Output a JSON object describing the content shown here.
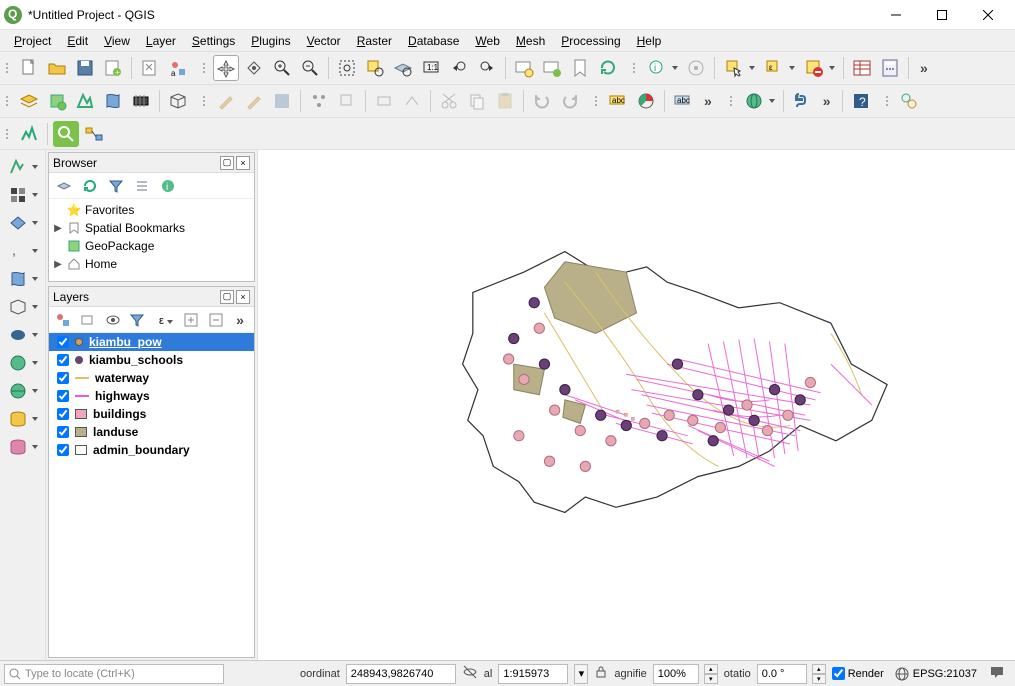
{
  "title": "*Untitled Project - QGIS",
  "menu": [
    "Project",
    "Edit",
    "View",
    "Layer",
    "Settings",
    "Plugins",
    "Vector",
    "Raster",
    "Database",
    "Web",
    "Mesh",
    "Processing",
    "Help"
  ],
  "browser": {
    "panel_title": "Browser",
    "items": [
      {
        "label": "Favorites",
        "icon": "star",
        "expandable": false
      },
      {
        "label": "Spatial Bookmarks",
        "icon": "bookmark",
        "expandable": true
      },
      {
        "label": "GeoPackage",
        "icon": "geopackage",
        "expandable": false
      },
      {
        "label": "Home",
        "icon": "home",
        "expandable": true
      }
    ]
  },
  "layers": {
    "panel_title": "Layers",
    "items": [
      {
        "name": "kiambu_pow",
        "checked": true,
        "selected": true,
        "swatch_type": "point",
        "color": "#d0a060"
      },
      {
        "name": "kiambu_schools",
        "checked": true,
        "selected": false,
        "swatch_type": "point",
        "color": "#6b3f78"
      },
      {
        "name": "waterway",
        "checked": true,
        "selected": false,
        "swatch_type": "line",
        "color": "#d8c26a"
      },
      {
        "name": "highways",
        "checked": true,
        "selected": false,
        "swatch_type": "line",
        "color": "#e85fcf"
      },
      {
        "name": "buildings",
        "checked": true,
        "selected": false,
        "swatch_type": "poly",
        "color": "#f3a6b9"
      },
      {
        "name": "landuse",
        "checked": true,
        "selected": false,
        "swatch_type": "poly",
        "color": "#b9b08a"
      },
      {
        "name": "admin_boundary",
        "checked": true,
        "selected": false,
        "swatch_type": "poly",
        "color": "#ffffff"
      }
    ]
  },
  "status": {
    "locate_placeholder": "Type to locate (Ctrl+K)",
    "coord_label": "oordinat",
    "coord_value": "248943,9826740",
    "scale_label": "al",
    "scale_value": "1:915973",
    "magnifier_label": "agnifie",
    "magnifier_value": "100%",
    "rotation_label": "otatio",
    "rotation_value": "0.0 °",
    "render_label": "Render",
    "render_checked": true,
    "crs": "EPSG:21037"
  },
  "colors": {
    "accent": "#2f7bd9",
    "highway": "#e85fcf",
    "waterway": "#d8c26a",
    "landuse": "#b9b08a",
    "school": "#6b3f78",
    "pow": "#e9a7b4"
  }
}
